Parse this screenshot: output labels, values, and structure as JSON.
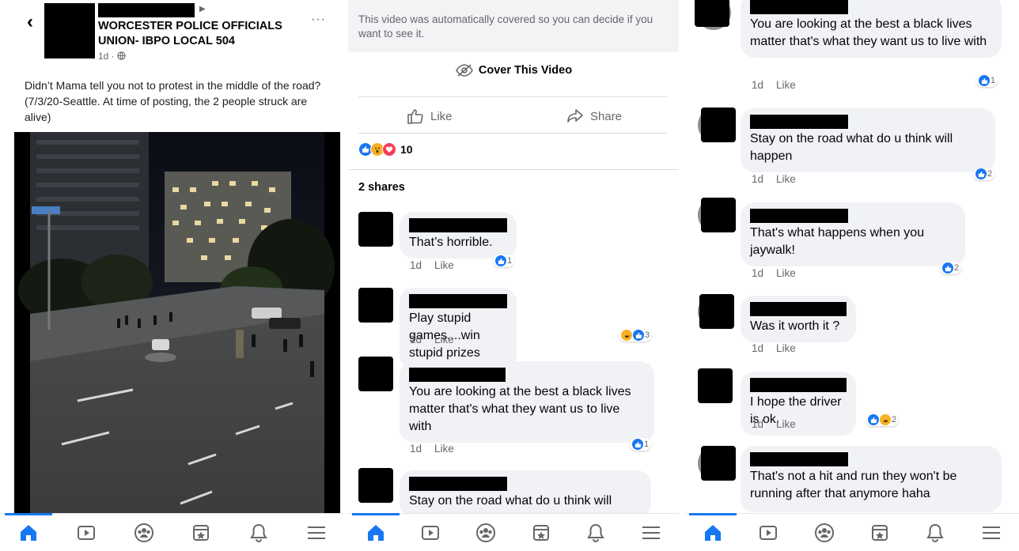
{
  "colors": {
    "brand": "#1877f2",
    "bubble": "#f0f2f5",
    "muted": "#65676b",
    "like": "#1877f2",
    "love": "#f33e58",
    "haha": "#f7b125"
  },
  "panel1": {
    "post": {
      "page_name": "WORCESTER POLICE OFFICIALS UNION- IBPO LOCAL 504",
      "timestamp": "1d · ",
      "text": "Didn’t Mama tell you not to protest in the middle of the road? (7/3/20-Seattle. At time of posting, the 2 people struck are alive)",
      "more": "···",
      "back": "‹"
    }
  },
  "panel2": {
    "covered_notice": "This video was automatically covered so you can decide if you want to see it.",
    "cover_label": "Cover This Video",
    "like_label": "Like",
    "share_label": "Share",
    "reaction_count": "10",
    "shares_label": "2 shares",
    "comments": [
      {
        "text": "That’s horrible.",
        "time": "1d",
        "like": "Like",
        "reactions": "1"
      },
      {
        "text": "Play stupid games....win stupid prizes",
        "time": "1d",
        "like": "Like",
        "reactions": "3"
      },
      {
        "text": "You are looking at the best a black lives matter that's what they want us to live with",
        "time": "1d",
        "like": "Like",
        "reactions": "1"
      },
      {
        "text": "Stay on the road what do u think will",
        "time": "",
        "like": "",
        "reactions": ""
      }
    ]
  },
  "panel3": {
    "comments": [
      {
        "text": "You are looking at the best a black lives matter that's what they want us to live with",
        "time": "1d",
        "like": "Like",
        "reactions": "1"
      },
      {
        "text": "Stay on the road what do u think will happen",
        "time": "1d",
        "like": "Like",
        "reactions": "2"
      },
      {
        "text": "That's what happens when you jaywalk!",
        "time": "1d",
        "like": "Like",
        "reactions": "2"
      },
      {
        "text": "Was it worth it ?",
        "time": "1d",
        "like": "Like",
        "reactions": ""
      },
      {
        "text": "I hope the driver is ok.",
        "time": "1d",
        "like": "Like",
        "reactions": "2"
      },
      {
        "text": "That's not a hit and run they won't be running after that anymore haha",
        "time": "",
        "like": "",
        "reactions": ""
      }
    ]
  },
  "tabbar": [
    "home-icon",
    "watch-icon",
    "groups-icon",
    "marketplace-icon",
    "notifications-icon",
    "menu-icon"
  ]
}
